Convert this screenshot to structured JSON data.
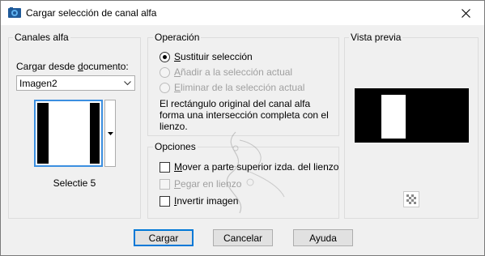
{
  "window": {
    "title": "Cargar selección de canal alfa"
  },
  "canales": {
    "group_label": "Canales alfa",
    "load_label_pre": "Cargar desde ",
    "load_label_u": "d",
    "load_label_post": "ocumento:",
    "document_selected": "Imagen2",
    "selection_caption": "Selectie 5"
  },
  "operacion": {
    "group_label": "Operación",
    "options": [
      {
        "u": "S",
        "rest": "ustituir selección",
        "checked": true,
        "enabled": true
      },
      {
        "u": "A",
        "rest": "ñadir a la selección actual",
        "checked": false,
        "enabled": false
      },
      {
        "u": "E",
        "rest": "liminar de la selección actual",
        "checked": false,
        "enabled": false
      }
    ],
    "description": "El rectángulo original del canal alfa forma una intersección completa con el lienzo."
  },
  "opciones": {
    "group_label": "Opciones",
    "items": [
      {
        "u": "M",
        "rest": "over a parte superior izda. del lienzo",
        "checked": false,
        "enabled": true
      },
      {
        "u": "P",
        "rest": "egar en lienzo",
        "checked": false,
        "enabled": false
      },
      {
        "u": "I",
        "rest": "nvertir imagen",
        "checked": false,
        "enabled": true
      }
    ]
  },
  "vista": {
    "group_label": "Vista previa"
  },
  "buttons": {
    "load": "Cargar",
    "cancel": "Cancelar",
    "help": "Ayuda"
  },
  "colors": {
    "accent": "#0078d7",
    "thumb_border": "#3b8fe0",
    "disabled_text": "#a0a0a0"
  },
  "icons": {
    "app": "paint-shop-pro-icon",
    "close": "close-icon",
    "dropdown": "chevron-down-icon",
    "preview_toggle": "checkerboard-icon"
  }
}
